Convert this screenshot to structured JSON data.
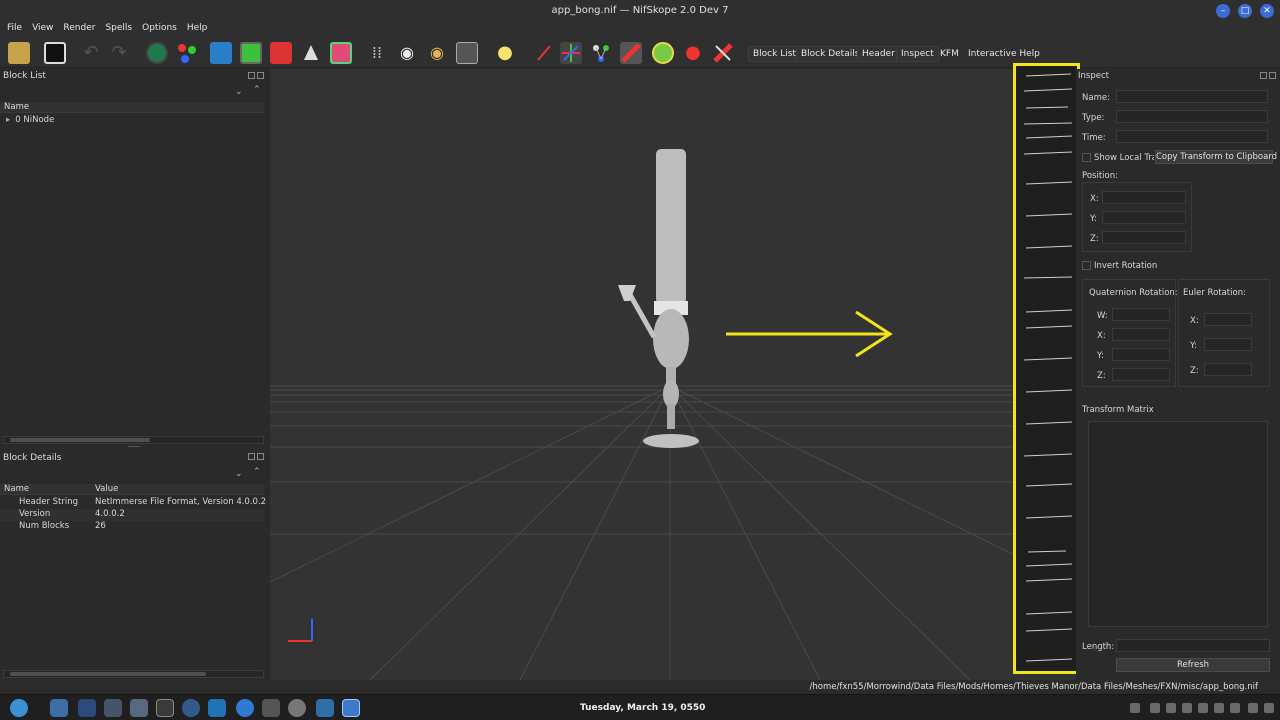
{
  "window": {
    "title": "app_bong.nif — NifSkope 2.0 Dev 7"
  },
  "menubar": {
    "items": [
      "File",
      "View",
      "Render",
      "Spells",
      "Options",
      "Help"
    ]
  },
  "toolbar": {
    "text_buttons": [
      "Block List",
      "Block Details",
      "Header",
      "Inspect",
      "KFM",
      "Interactive Help"
    ]
  },
  "block_list": {
    "title": "Block List",
    "column_header": "Name",
    "rows": [
      {
        "label": "0 NiNode"
      }
    ]
  },
  "block_details": {
    "title": "Block Details",
    "columns": [
      "Name",
      "Value"
    ],
    "rows": [
      {
        "name": "Header String",
        "value": "NetImmerse File Format, Version 4.0.0.2"
      },
      {
        "name": "Version",
        "value": "4.0.0.2"
      },
      {
        "name": "Num Blocks",
        "value": "26"
      }
    ]
  },
  "inspect": {
    "title": "Inspect",
    "name_label": "Name:",
    "type_label": "Type:",
    "time_label": "Time:",
    "show_local_label": "Show Local Trar",
    "copy_button": "Copy Transform to Clipboard",
    "position_label": "Position:",
    "x_label": "X:",
    "y_label": "Y:",
    "z_label": "Z:",
    "w_label": "W:",
    "invert_rotation_label": "Invert Rotation",
    "quaternion_label": "Quaternion Rotation:",
    "euler_label": "Euler Rotation:",
    "transform_matrix_label": "Transform Matrix",
    "length_label": "Length:",
    "refresh_button": "Refresh"
  },
  "statusbar": {
    "path": "/home/fxn55/Morrowind/Data Files/Mods/Homes/Thieves Manor/Data Files/Meshes/FXN/misc/app_bong.nif"
  },
  "taskbar": {
    "clock": "Tuesday, March 19, 0550"
  },
  "colors": {
    "highlight": "#f2e51a",
    "background": "#2b2b2b",
    "viewport": "#333333"
  }
}
